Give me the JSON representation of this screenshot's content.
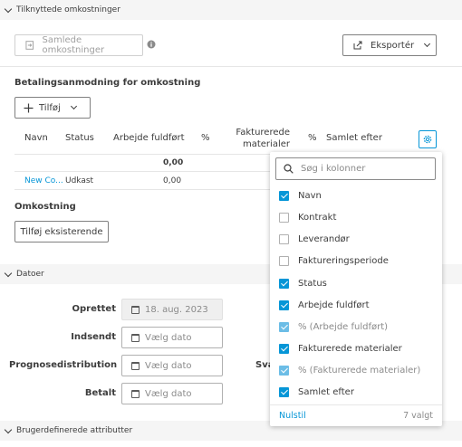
{
  "sections": {
    "linked_costs": "Tilknyttede omkostninger",
    "dates": "Datoer",
    "custom_attributes": "Brugerdefinerede attributter"
  },
  "toolbar": {
    "collected_costs_label": "Samlede omkostninger",
    "export_label": "Eksportér"
  },
  "payment_request": {
    "heading": "Betalingsanmodning for omkostning",
    "add_label": "Tilføj",
    "columns": [
      "Navn",
      "Status",
      "Arbejde fuldført",
      "%",
      "Fakturerede materialer",
      "%",
      "Samlet efter"
    ],
    "total_row": {
      "work_completed": "0,00"
    },
    "rows": [
      {
        "name": "New Co...",
        "status": "Udkast",
        "work_completed": "0,00"
      }
    ]
  },
  "cost": {
    "heading": "Omkostning",
    "add_existing_label": "Tilføj eksisterende"
  },
  "dates": {
    "created_label": "Oprettet",
    "created_value": "18. aug. 2023",
    "sent_label": "Indsendt",
    "sent_placeholder": "Vælg dato",
    "forecast_label": "Prognosedistribution",
    "forecast_placeholder": "Vælg dato",
    "paid_label": "Betalt",
    "paid_placeholder": "Vælg dato",
    "hidden_label_fragment": "Sva"
  },
  "column_picker": {
    "search_placeholder": "Søg i kolonner",
    "options": [
      {
        "label": "Navn",
        "checked": true,
        "disabled": false
      },
      {
        "label": "Kontrakt",
        "checked": false,
        "disabled": false
      },
      {
        "label": "Leverandør",
        "checked": false,
        "disabled": false
      },
      {
        "label": "Faktureringsperiode",
        "checked": false,
        "disabled": false
      },
      {
        "label": "Status",
        "checked": true,
        "disabled": false
      },
      {
        "label": "Arbejde fuldført",
        "checked": true,
        "disabled": false
      },
      {
        "label": "% (Arbejde fuldført)",
        "checked": true,
        "disabled": true
      },
      {
        "label": "Fakturerede materialer",
        "checked": true,
        "disabled": false
      },
      {
        "label": "% (Fakturerede materialer)",
        "checked": true,
        "disabled": true
      },
      {
        "label": "Samlet efter",
        "checked": true,
        "disabled": false
      }
    ],
    "reset_label": "Nulstil",
    "selected_count": "7 valgt"
  },
  "colors": {
    "accent": "#0696d7",
    "link": "#0696d7"
  }
}
